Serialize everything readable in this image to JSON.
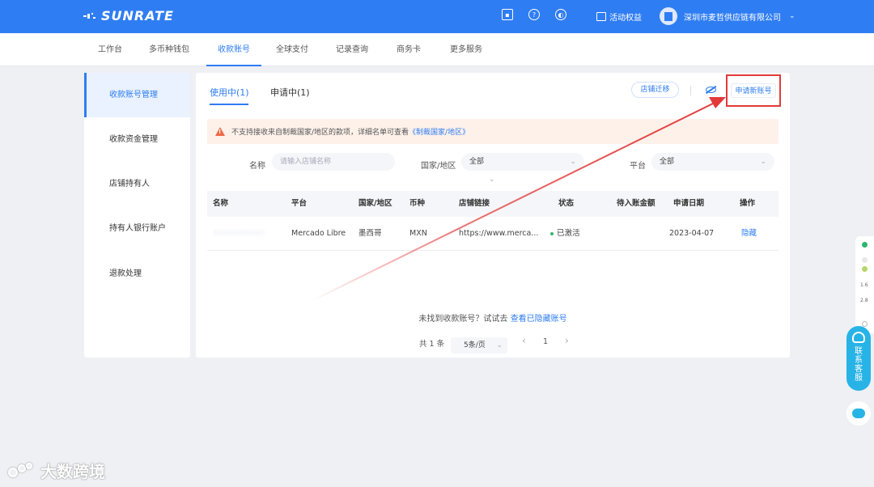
{
  "brand": {
    "name": "SUNRATE"
  },
  "header": {
    "icons": [
      "calendar-icon",
      "help-icon",
      "globe-icon"
    ],
    "activity_label": "活动权益",
    "company": "深圳市麦哲供应链有限公司",
    "chevron": "⌄"
  },
  "nav": {
    "items": [
      "工作台",
      "多币种钱包",
      "收款账号",
      "全球支付",
      "记录查询",
      "商务卡",
      "更多服务"
    ],
    "active_index": 2
  },
  "sidebar": {
    "items": [
      "收款账号管理",
      "收款资金管理",
      "店铺持有人",
      "持有人银行账户",
      "退款处理"
    ],
    "active_index": 0
  },
  "main": {
    "tabs": [
      "使用中(1)",
      "申请中(1)"
    ],
    "migrate_button": "店铺迁移",
    "apply_button": "申请新账号",
    "warning": {
      "text": "不支持接收来自制裁国家/地区的款项，详细名单可查看",
      "link": "《制裁国家/地区》"
    },
    "filters": {
      "name_label": "名称",
      "name_placeholder": "请输入店铺名称",
      "country_label": "国家/地区",
      "country_value": "全部",
      "platform_label": "平台",
      "platform_value": "全部"
    },
    "table": {
      "headers": [
        "名称",
        "平台",
        "国家/地区",
        "币种",
        "店铺链接",
        "状态",
        "待入账金额",
        "申请日期",
        "操作"
      ],
      "rows": [
        {
          "name": "·····················",
          "platform": "Mercado Libre",
          "country": "墨西哥",
          "currency": "MXN",
          "link": "https://www.merca...",
          "status": "已激活",
          "pending": "",
          "date": "2023-04-07",
          "action": "隐藏"
        }
      ]
    },
    "empty_hint": {
      "text": "未找到收款账号？试试去",
      "link": "查看已隐藏账号"
    },
    "pagination": {
      "total": "共 1 条",
      "page_size": "5条/页",
      "prev": "‹",
      "current": "1",
      "next": "›"
    }
  },
  "float": {
    "stats": [
      "1.6",
      "2.8"
    ],
    "contact_label": "联系客服"
  },
  "watermark": {
    "text": "大数跨境"
  },
  "colors": {
    "primary": "#2f7df3",
    "highlight": "#e23a3a",
    "warning_bg": "#fdf1ea",
    "status_green": "#38b26b"
  }
}
